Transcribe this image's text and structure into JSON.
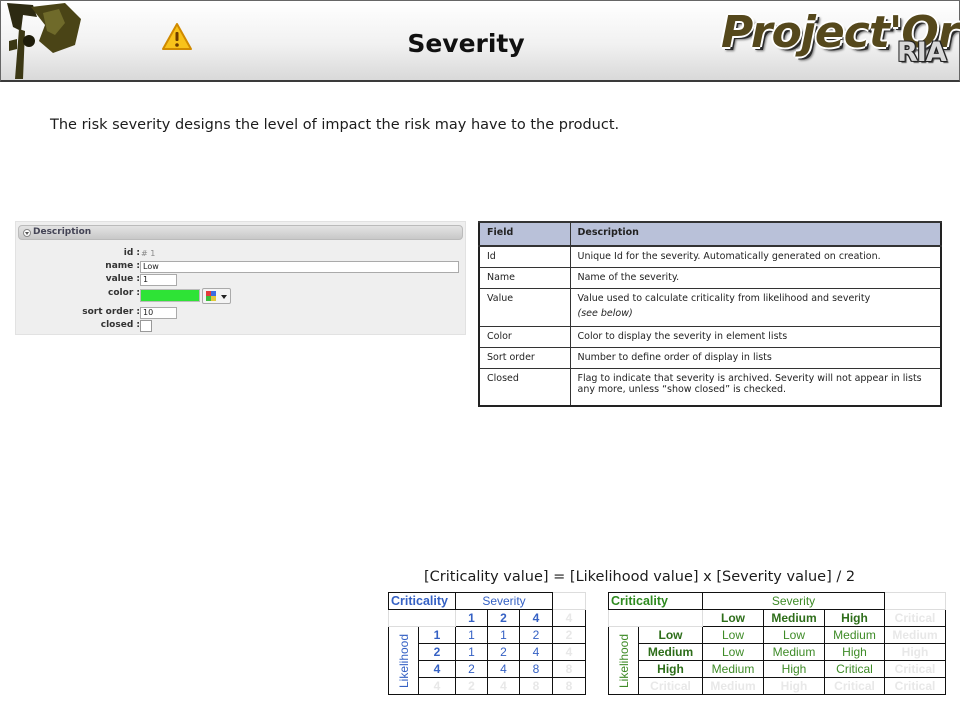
{
  "header": {
    "title": "Severity",
    "brand": "Project'Or",
    "brand_suffix": "RIA"
  },
  "intro": "The risk severity designs the level of impact the risk may have to the product.",
  "form": {
    "section_title": "Description",
    "id_label": "id :",
    "id_value": "# 1",
    "name_label": "name :",
    "name_value": "Low",
    "value_label": "value :",
    "value_value": "1",
    "color_label": "color :",
    "color_value": "#2ee336",
    "sort_label": "sort order :",
    "sort_value": "10",
    "closed_label": "closed :"
  },
  "fields_table": {
    "headers": [
      "Field",
      "Description"
    ],
    "rows": [
      {
        "field": "Id",
        "desc": "Unique Id for the severity. Automatically generated on creation."
      },
      {
        "field": "Name",
        "desc": "Name of the severity."
      },
      {
        "field": "Value",
        "desc": "Value used to calculate criticality from likelihood and severity",
        "note": "(see below)"
      },
      {
        "field": "Color",
        "desc": "Color to display the severity in element lists"
      },
      {
        "field": "Sort order",
        "desc": "Number to define order of display in lists"
      },
      {
        "field": "Closed",
        "desc": "Flag to indicate that severity is archived. Severity will not appear in lists any more, unless “show closed” is checked."
      }
    ]
  },
  "formula": "[Criticality value] = [Likelihood value] x [Severity value] / 2",
  "matrix_values": {
    "corner": "Criticality",
    "severity_label": "Severity",
    "likelihood_label": "Likelihood",
    "col_headers": [
      "1",
      "2",
      "4",
      "4"
    ],
    "row_headers": [
      "1",
      "2",
      "4",
      "4"
    ],
    "rows": [
      [
        "1",
        "1",
        "2",
        "2"
      ],
      [
        "1",
        "2",
        "4",
        "4"
      ],
      [
        "2",
        "4",
        "8",
        "8"
      ],
      [
        "2",
        "4",
        "8",
        "8"
      ]
    ]
  },
  "matrix_names": {
    "corner": "Criticality",
    "severity_label": "Severity",
    "likelihood_label": "Likelihood",
    "col_headers": [
      "Low",
      "Medium",
      "High",
      "Critical"
    ],
    "row_headers": [
      "Low",
      "Medium",
      "High",
      "Critical"
    ],
    "rows": [
      [
        "Low",
        "Low",
        "Medium",
        "Medium"
      ],
      [
        "Low",
        "Medium",
        "High",
        "High"
      ],
      [
        "Medium",
        "High",
        "Critical",
        "Critical"
      ],
      [
        "Medium",
        "High",
        "Critical",
        "Critical"
      ]
    ]
  },
  "colors": {
    "values_matrix_text": "#3561c4",
    "names_matrix_text": "#3e8b27",
    "table_header_bg": "#b9c1d9",
    "header_rule": "#3a3a3a"
  },
  "icons": [
    "warning-icon",
    "project-logo-figure",
    "section-collapse-icon",
    "color-palette-icon",
    "chevron-down-icon"
  ]
}
